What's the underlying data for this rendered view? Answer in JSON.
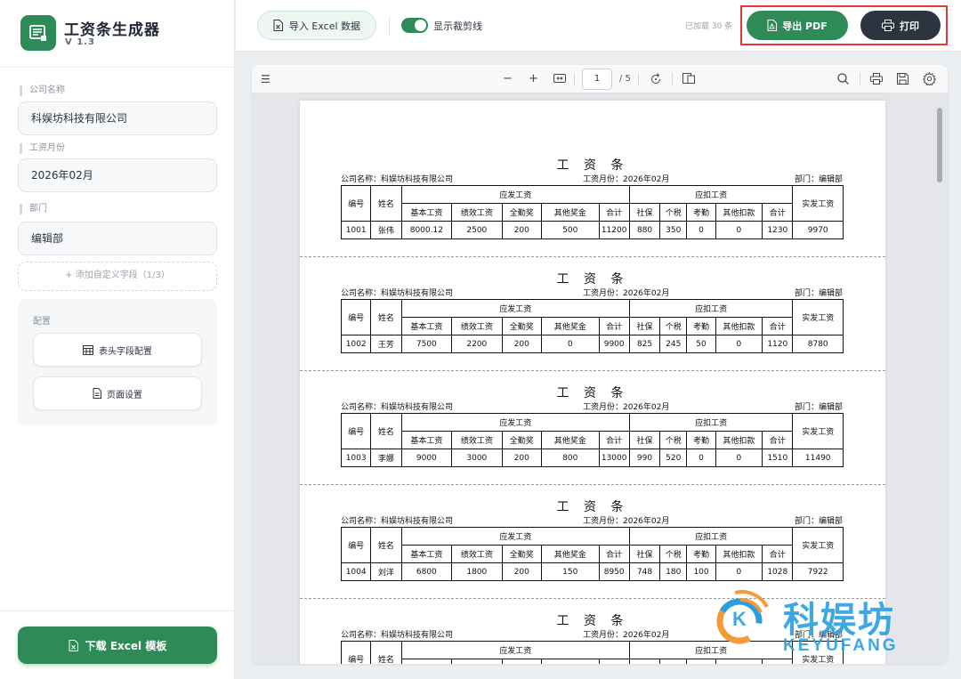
{
  "app": {
    "title": "工资条生成器",
    "version": "V 1.3"
  },
  "sidebar": {
    "fields": [
      {
        "label": "公司名称",
        "value": "科娱坊科技有限公司"
      },
      {
        "label": "工资月份",
        "value": "2026年02月"
      },
      {
        "label": "部门",
        "value": "编辑部"
      }
    ],
    "add_field": "+ 添加自定义字段（1/3）",
    "config": {
      "title": "配置",
      "header_btn": "表头字段配置",
      "page_btn": "页面设置"
    },
    "download": "下载 Excel 模板"
  },
  "toolbar": {
    "import": "导入 Excel 数据",
    "toggle_label": "显示裁剪线",
    "loaded": "已加载 30 条",
    "pdf": "导出 PDF",
    "print": "打印"
  },
  "viewer": {
    "page": "1",
    "page_count": "/ 5"
  },
  "slips": {
    "title": "工 资 条",
    "company": "公司名称：科娱坊科技有限公司",
    "month": "工资月份：2026年02月",
    "dept": "部门：编辑部",
    "headers": {
      "id": "编号",
      "name": "姓名",
      "payable": "应发工资",
      "deduct": "应扣工资",
      "net": "实发工资",
      "base": "基本工资",
      "perf": "绩效工资",
      "attend": "全勤奖",
      "bonus": "其他奖金",
      "total": "合计",
      "social": "社保",
      "tax": "个税",
      "absence": "考勤",
      "other_deduct": "其他扣款",
      "total2": "合计"
    },
    "rows": [
      {
        "id": "1001",
        "name": "张伟",
        "base": "8000.12",
        "perf": "2500",
        "attend": "200",
        "bonus": "500",
        "total": "11200",
        "social": "880",
        "tax": "350",
        "absence": "0",
        "other": "0",
        "dtotal": "1230",
        "net": "9970"
      },
      {
        "id": "1002",
        "name": "王芳",
        "base": "7500",
        "perf": "2200",
        "attend": "200",
        "bonus": "0",
        "total": "9900",
        "social": "825",
        "tax": "245",
        "absence": "50",
        "other": "0",
        "dtotal": "1120",
        "net": "8780"
      },
      {
        "id": "1003",
        "name": "李娜",
        "base": "9000",
        "perf": "3000",
        "attend": "200",
        "bonus": "800",
        "total": "13000",
        "social": "990",
        "tax": "520",
        "absence": "0",
        "other": "0",
        "dtotal": "1510",
        "net": "11490"
      },
      {
        "id": "1004",
        "name": "刘洋",
        "base": "6800",
        "perf": "1800",
        "attend": "200",
        "bonus": "150",
        "total": "8950",
        "social": "748",
        "tax": "180",
        "absence": "100",
        "other": "0",
        "dtotal": "1028",
        "net": "7922"
      }
    ]
  },
  "watermark": {
    "cn": "科娱坊",
    "en": "KEYUFANG",
    "mark": "K"
  },
  "colors": {
    "accent": "#2e8b57",
    "dark": "#2c3440",
    "highlight": "#e53935"
  }
}
